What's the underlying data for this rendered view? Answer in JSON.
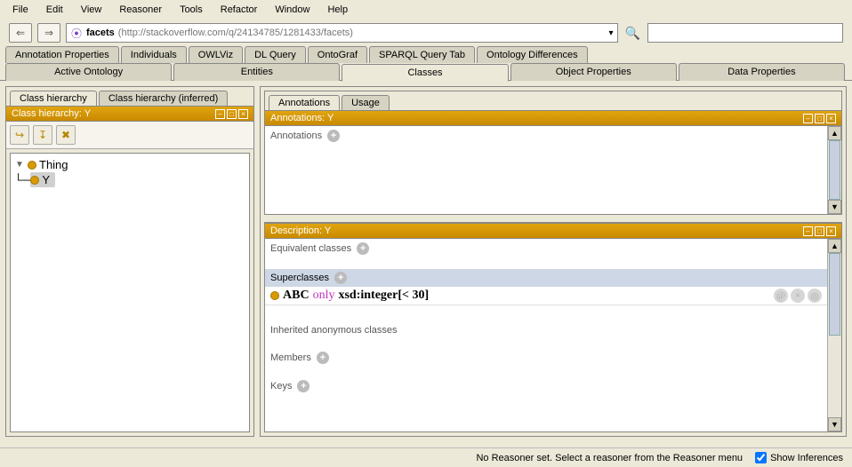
{
  "menu": [
    "File",
    "Edit",
    "View",
    "Reasoner",
    "Tools",
    "Refactor",
    "Window",
    "Help"
  ],
  "uri": {
    "name": "facets",
    "path": "(http://stackoverflow.com/q/24134785/1281433/facets)"
  },
  "tabs_primary": [
    "Annotation Properties",
    "Individuals",
    "OWLViz",
    "DL Query",
    "OntoGraf",
    "SPARQL Query Tab",
    "Ontology Differences"
  ],
  "tabs_secondary": [
    "Active Ontology",
    "Entities",
    "Classes",
    "Object Properties",
    "Data Properties"
  ],
  "tabs_secondary_active": 2,
  "left": {
    "subtabs": [
      "Class hierarchy",
      "Class hierarchy (inferred)"
    ],
    "subtab_active": 0,
    "header": "Class hierarchy: Y",
    "tree": {
      "root": "Thing",
      "children": [
        "Y"
      ],
      "selected": "Y"
    }
  },
  "right": {
    "ann": {
      "subtabs": [
        "Annotations",
        "Usage"
      ],
      "subtab_active": 0,
      "header": "Annotations: Y",
      "sections": [
        {
          "label": "Annotations"
        }
      ]
    },
    "desc": {
      "header": "Description: Y",
      "equiv_label": "Equivalent classes",
      "super_label": "Superclasses",
      "axiom": {
        "cls": "ABC",
        "kw": "only",
        "rest": "xsd:integer[< 30]"
      },
      "inherited_label": "Inherited anonymous classes",
      "members_label": "Members",
      "keys_label": "Keys"
    }
  },
  "status": {
    "msg": "No Reasoner set. Select a reasoner from the Reasoner menu",
    "checkbox_label": "Show Inferences",
    "checkbox_checked": true
  }
}
